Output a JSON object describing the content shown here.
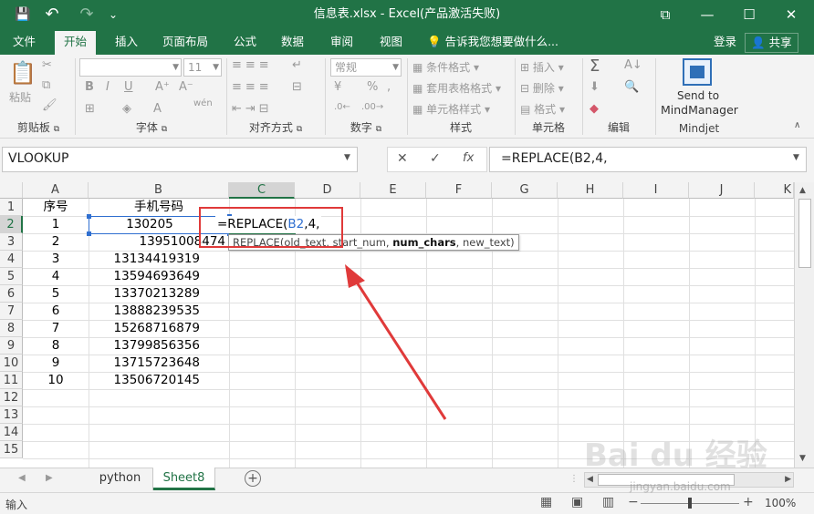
{
  "window": {
    "title": "信息表.xlsx - Excel(产品激活失败)",
    "quick_access": {
      "save_icon": "💾",
      "undo_icon": "↶",
      "redo_icon": "↷",
      "more_icon": "⌄"
    },
    "controls": {
      "ribbon_opts": "⧉",
      "minimize": "—",
      "maximize": "☐",
      "close": "✕"
    }
  },
  "tabs": [
    "文件",
    "开始",
    "插入",
    "页面布局",
    "公式",
    "数据",
    "审阅",
    "视图"
  ],
  "tell_me": "告诉我您想要做什么...",
  "login": "登录",
  "share": "共享",
  "ribbon": {
    "groups": {
      "clipboard": "剪贴板",
      "font": "字体",
      "align": "对齐方式",
      "number": "数字",
      "styles": "样式",
      "cells": "单元格",
      "editing": "编辑",
      "mindjet": "Mindjet"
    },
    "paste": "粘贴",
    "font_size": "11",
    "number_format": "常规",
    "cond_format": "条件格式",
    "table_format": "套用表格格式",
    "cell_style": "单元格样式",
    "insert": "插入",
    "delete": "删除",
    "format": "格式",
    "send_to": "Send to",
    "mindmanager": "MindManager",
    "bold": "B",
    "italic": "I",
    "underline": "U",
    "wen": "wén",
    "pct": "%"
  },
  "formula_bar": {
    "name_box": "VLOOKUP",
    "formula": "=REPLACE(B2,4,",
    "fx": "fx",
    "cancel": "✕",
    "enter": "✓"
  },
  "columns": [
    "A",
    "B",
    "C",
    "D",
    "E",
    "F",
    "G",
    "H",
    "I",
    "J",
    "K"
  ],
  "rows": [
    "1",
    "2",
    "3",
    "4",
    "5",
    "6",
    "7",
    "8",
    "9",
    "10",
    "11",
    "12",
    "13",
    "14",
    "15"
  ],
  "cells": {
    "A1": "序号",
    "B1": "手机号码",
    "A2": "1",
    "B2": "130205",
    "A3": "2",
    "B3": "13951008474",
    "A4": "3",
    "B4": "13134419319",
    "A5": "4",
    "B5": "13594693649",
    "A6": "5",
    "B6": "13370213289",
    "A7": "6",
    "B7": "13888239535",
    "A8": "7",
    "B8": "15268716879",
    "A9": "8",
    "B9": "13799856356",
    "A10": "9",
    "B10": "13715723648",
    "A11": "10",
    "B11": "13506720145"
  },
  "editing_cell": {
    "prefix": "=REPLACE(",
    "ref": "B2",
    "suffix": ",4,"
  },
  "tooltip": {
    "fn": "REPLACE(",
    "a1": "old_text, ",
    "a2": "start_num, ",
    "a3": "num_chars",
    "a4": ", new_text)"
  },
  "accent": "#217346",
  "annotation_color": "#e03a3a",
  "sheets": [
    "python",
    "Sheet8"
  ],
  "active_sheet": "Sheet8",
  "status": {
    "mode": "输入",
    "zoom": "100%"
  },
  "watermark": {
    "brand": "Bai du 经验",
    "url": "jingyan.baidu.com"
  }
}
